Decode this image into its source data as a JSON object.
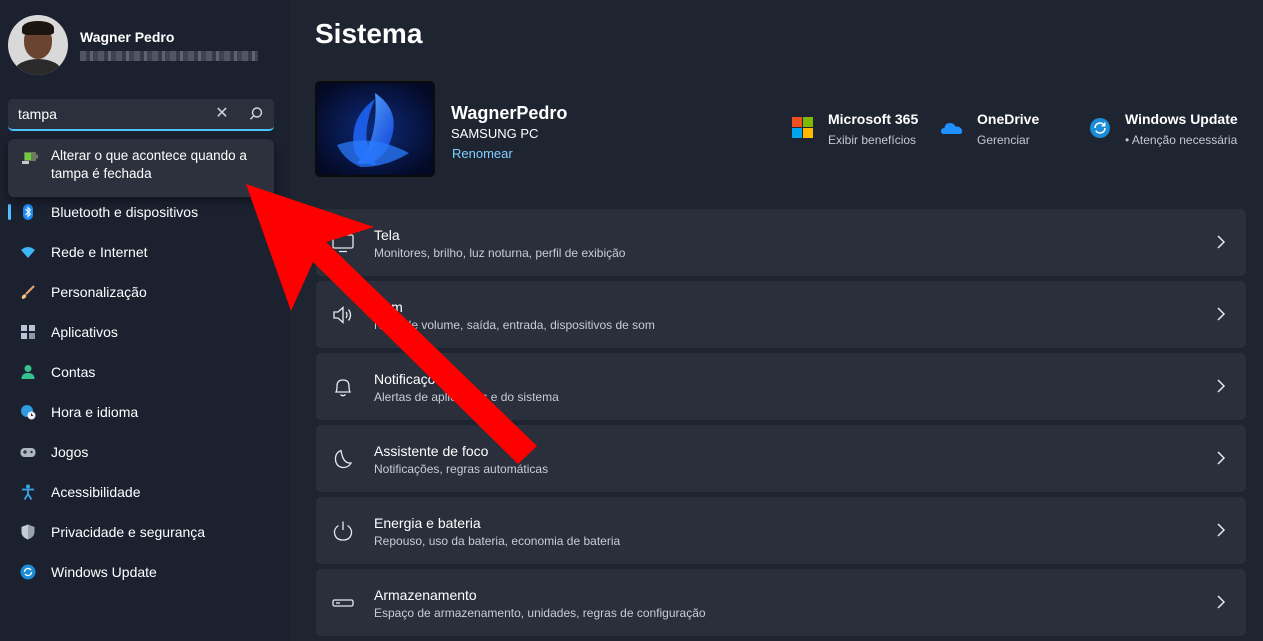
{
  "profile": {
    "name": "Wagner Pedro"
  },
  "search": {
    "value": "tampa",
    "clear_icon": "close-icon",
    "search_icon": "search-icon"
  },
  "suggestion": {
    "text": "Alterar o que acontece quando a tampa é fechada"
  },
  "nav": {
    "items": [
      {
        "label": "Bluetooth e dispositivos",
        "icon": "bluetooth-icon"
      },
      {
        "label": "Rede e Internet",
        "icon": "wifi-icon"
      },
      {
        "label": "Personalização",
        "icon": "brush-icon"
      },
      {
        "label": "Aplicativos",
        "icon": "apps-icon"
      },
      {
        "label": "Contas",
        "icon": "person-icon"
      },
      {
        "label": "Hora e idioma",
        "icon": "globe-clock-icon"
      },
      {
        "label": "Jogos",
        "icon": "gamepad-icon"
      },
      {
        "label": "Acessibilidade",
        "icon": "accessibility-icon"
      },
      {
        "label": "Privacidade e segurança",
        "icon": "shield-icon"
      },
      {
        "label": "Windows Update",
        "icon": "update-icon"
      }
    ]
  },
  "main": {
    "title": "Sistema",
    "device": {
      "name": "WagnerPedro",
      "model": "SAMSUNG PC",
      "rename_label": "Renomear"
    },
    "quick_links": [
      {
        "title": "Microsoft 365",
        "subtitle": "Exibir benefícios",
        "icon": "microsoft-logo-icon"
      },
      {
        "title": "OneDrive",
        "subtitle": "Gerenciar",
        "icon": "cloud-icon"
      },
      {
        "title": "Windows Update",
        "subtitle": "• Atenção necessária",
        "icon": "update-icon"
      }
    ],
    "cards": [
      {
        "title": "Tela",
        "subtitle": "Monitores, brilho, luz noturna, perfil de exibição",
        "icon": "monitor-icon"
      },
      {
        "title": "Som",
        "subtitle": "Nível de volume, saída, entrada, dispositivos de som",
        "icon": "speaker-icon"
      },
      {
        "title": "Notificações",
        "subtitle": "Alertas de aplicativos e do sistema",
        "icon": "bell-icon"
      },
      {
        "title": "Assistente de foco",
        "subtitle": "Notificações, regras automáticas",
        "icon": "moon-icon"
      },
      {
        "title": "Energia e bateria",
        "subtitle": "Repouso, uso da bateria, economia de bateria",
        "icon": "power-icon"
      },
      {
        "title": "Armazenamento",
        "subtitle": "Espaço de armazenamento, unidades, regras de configuração",
        "icon": "drive-icon"
      }
    ]
  },
  "colors": {
    "accent": "#4cc2ff",
    "annotation_arrow": "#ff0000",
    "background": "#1f2431",
    "card": "#2a2f3b"
  }
}
